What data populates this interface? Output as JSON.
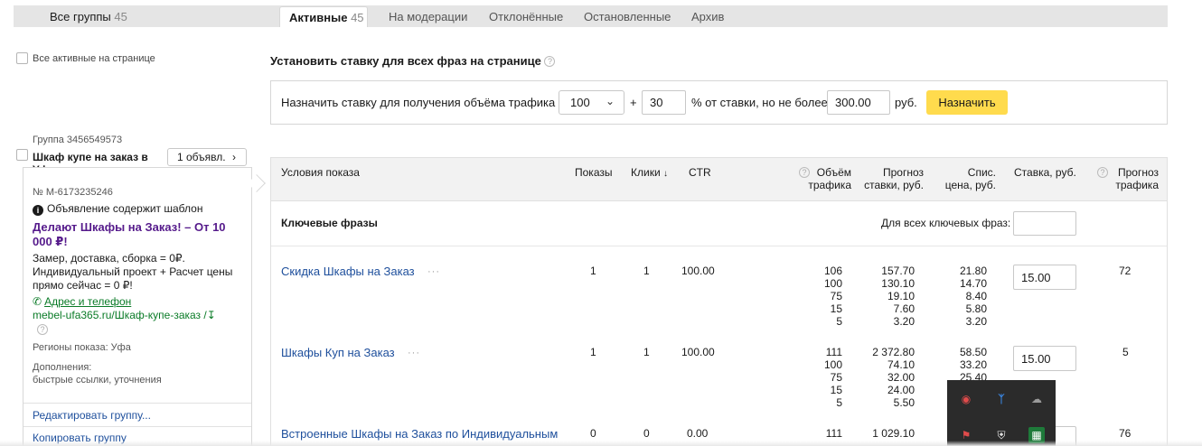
{
  "tabs": {
    "all_label": "Все группы",
    "all_count": "45",
    "active_label": "Активные",
    "active_count": "45",
    "moderation": "На модерации",
    "rejected": "Отклонённые",
    "stopped": "Остановленные",
    "archive": "Архив"
  },
  "all_active_label": "Все активные на странице",
  "set_bid": {
    "title": "Установить ставку для всех фраз на странице",
    "help": "?",
    "label": "Назначить ставку для получения объёма трафика",
    "traffic_value": "100",
    "plus": "+",
    "percent_value": "30",
    "percent_label": "% от ставки, но не более",
    "max_value": "300.00",
    "currency": "руб.",
    "assign_button": "Назначить"
  },
  "group": {
    "id_label": "Группа 3456549573",
    "title": "Шкаф купе на заказ в Уфе",
    "ads_button": "1 объявл.",
    "ad_number": "№ M-6173235246",
    "template_note": "Объявление содержит шаблон",
    "headline": "Делают Шкафы на Заказ! – От 10 000 ₽!",
    "text": "Замер, доставка, сборка = 0₽. Индивидуальный проект + Расчет цены прямо сейчас = 0 ₽!",
    "address_link": "Адрес и телефон",
    "url": "mebel-ufa365.ru/Шкаф-купе-заказ /",
    "regions": "Регионы показа: Уфа",
    "extras_title": "Дополнения:",
    "extras": "быстрые ссылки, уточнения",
    "edit_link": "Редактировать группу...",
    "copy_link": "Копировать группу"
  },
  "table": {
    "headers": {
      "conditions": "Условия показа",
      "shows": "Показы",
      "clicks": "Клики",
      "clicks_sort": "↓",
      "ctr": "CTR",
      "traffic": "Объём трафика",
      "forecast_bid": "Прогноз ставки, руб.",
      "write_off": "Спис. цена, руб.",
      "bid": "Ставка, руб.",
      "forecast_traffic": "Прогноз трафика"
    },
    "keywords_title": "Ключевые фразы",
    "keywords_all_label": "Для всех ключевых фраз:",
    "rows": [
      {
        "phrase": "Скидка Шкафы на Заказ",
        "shows": "1",
        "clicks": "1",
        "ctr": "100.00",
        "traffic": [
          "106",
          "100",
          "75",
          "15",
          "5"
        ],
        "forecast": [
          "157.70",
          "130.10",
          "19.10",
          "7.60",
          "3.20"
        ],
        "write_off": [
          "21.80",
          "14.70",
          "8.40",
          "5.80",
          "3.20"
        ],
        "bid": "15.00",
        "forecast_traffic": "72"
      },
      {
        "phrase": "Шкафы Куп на Заказ",
        "shows": "1",
        "clicks": "1",
        "ctr": "100.00",
        "traffic": [
          "111",
          "100",
          "75",
          "15",
          "5"
        ],
        "forecast": [
          "2 372.80",
          "74.10",
          "32.00",
          "24.00",
          "5.50"
        ],
        "write_off": [
          "58.50",
          "33.20",
          "25.40",
          "",
          ""
        ],
        "bid": "15.00",
        "forecast_traffic": "5"
      },
      {
        "phrase": "Встроенные Шкафы на Заказ по Индивидуальным",
        "shows": "0",
        "clicks": "0",
        "ctr": "0.00",
        "traffic": [
          "111"
        ],
        "forecast": [
          "1 029.10"
        ],
        "write_off": [],
        "bid": "",
        "forecast_traffic": "76"
      }
    ],
    "dots": "···"
  },
  "tray_icons": [
    "security-shield-icon",
    "bluetooth-icon",
    "cloud-icon",
    "flag-icon",
    "defender-icon",
    "spreadsheet-icon"
  ]
}
